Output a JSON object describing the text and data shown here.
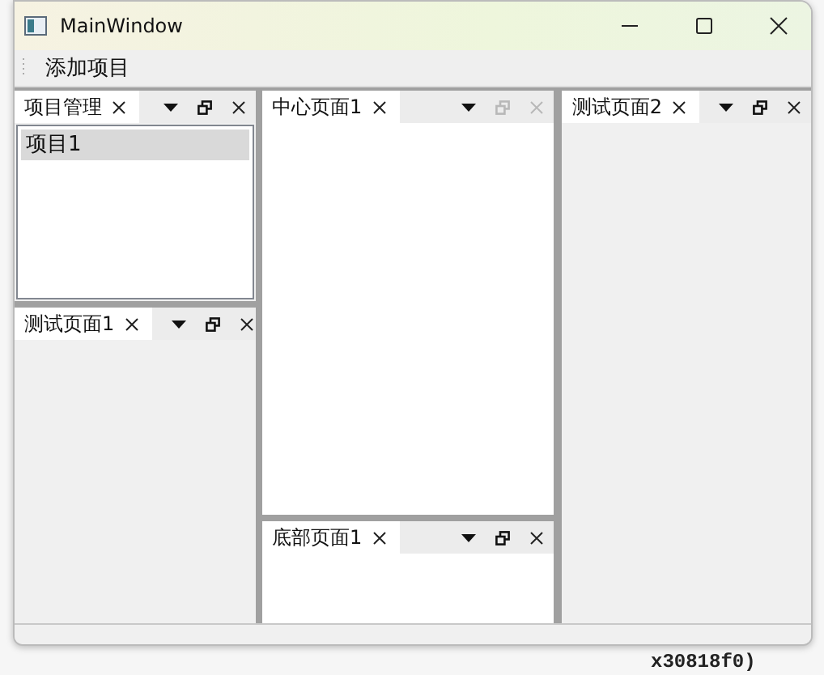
{
  "window": {
    "title": "MainWindow"
  },
  "toolbar": {
    "actions": [
      "添加项目"
    ]
  },
  "columns": [
    {
      "docks": [
        {
          "tab": "项目管理",
          "disabled": false,
          "kind": "list",
          "items": [
            {
              "label": "项目1",
              "selected": true
            }
          ]
        },
        {
          "tab": "测试页面1",
          "disabled": false,
          "kind": "panel"
        }
      ]
    },
    {
      "docks": [
        {
          "tab": "中心页面1",
          "disabled": true,
          "kind": "blank"
        },
        {
          "tab": "底部页面1",
          "disabled": false,
          "kind": "blank"
        }
      ]
    },
    {
      "docks": [
        {
          "tab": "测试页面2",
          "disabled": false,
          "kind": "panel"
        }
      ]
    }
  ],
  "background": {
    "text": "x30818f0)"
  }
}
